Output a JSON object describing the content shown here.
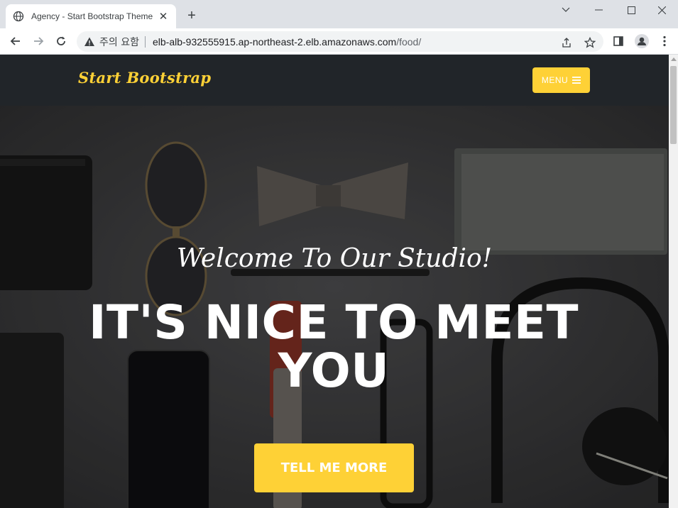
{
  "browser": {
    "tab_title": "Agency - Start Bootstrap Theme",
    "security_label": "주의 요함",
    "url_host": "elb-alb-932555915.ap-northeast-2.elb.amazonaws.com",
    "url_path": "/food/"
  },
  "nav": {
    "brand": "Start Bootstrap",
    "menu_label": "MENU"
  },
  "hero": {
    "lead": "Welcome To Our Studio!",
    "heading_line1": "IT'S NICE TO MEET",
    "heading_line2": "YOU",
    "cta": "TELL ME MORE"
  },
  "colors": {
    "accent": "#fed136",
    "navbar": "#212529"
  }
}
